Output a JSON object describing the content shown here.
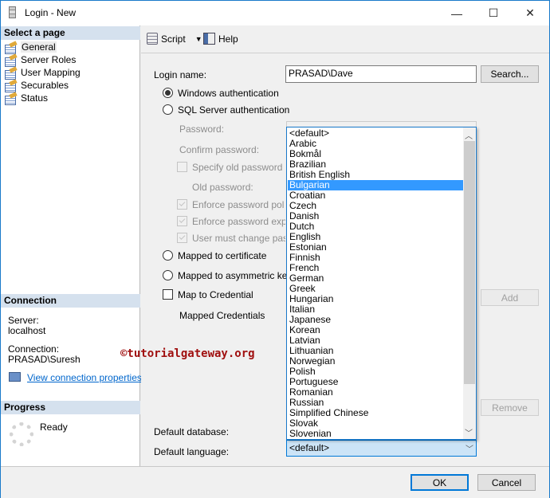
{
  "window": {
    "title": "Login - New",
    "minimize": "—",
    "maximize": "☐",
    "close": "✕"
  },
  "sidebar": {
    "header": "Select a page",
    "items": [
      {
        "label": "General"
      },
      {
        "label": "Server Roles"
      },
      {
        "label": "User Mapping"
      },
      {
        "label": "Securables"
      },
      {
        "label": "Status"
      }
    ]
  },
  "connection": {
    "header": "Connection",
    "server_label": "Server:",
    "server_value": "localhost",
    "connection_label": "Connection:",
    "connection_value": "PRASAD\\Suresh",
    "link": "View connection properties"
  },
  "progress": {
    "header": "Progress",
    "status": "Ready"
  },
  "toolbar": {
    "script": "Script",
    "help": "Help"
  },
  "form": {
    "login_name_label": "Login name:",
    "login_name_value": "PRASAD\\Dave",
    "search": "Search...",
    "windows_auth": "Windows authentication",
    "sql_auth": "SQL Server authentication",
    "password": "Password:",
    "confirm_password": "Confirm password:",
    "specify_old": "Specify old password",
    "old_password": "Old password:",
    "enforce_policy": "Enforce password policy",
    "enforce_expiration": "Enforce password expirat",
    "must_change": "User must change passw",
    "mapped_cert": "Mapped to certificate",
    "mapped_key": "Mapped to asymmetric key",
    "map_credential": "Map to Credential",
    "mapped_credentials": "Mapped Credentials",
    "add": "Add",
    "remove": "Remove",
    "default_database": "Default database:",
    "default_language": "Default language:",
    "default_language_value": "<default>"
  },
  "language_list": {
    "selected": "Bulgarian",
    "items": [
      "<default>",
      "Arabic",
      "Bokmål",
      "Brazilian",
      "British English",
      "Bulgarian",
      "Croatian",
      "Czech",
      "Danish",
      "Dutch",
      "English",
      "Estonian",
      "Finnish",
      "French",
      "German",
      "Greek",
      "Hungarian",
      "Italian",
      "Japanese",
      "Korean",
      "Latvian",
      "Lithuanian",
      "Norwegian",
      "Polish",
      "Portuguese",
      "Romanian",
      "Russian",
      "Simplified Chinese",
      "Slovak",
      "Slovenian"
    ]
  },
  "watermark": "©tutorialgateway.org",
  "buttons": {
    "ok": "OK",
    "cancel": "Cancel"
  }
}
